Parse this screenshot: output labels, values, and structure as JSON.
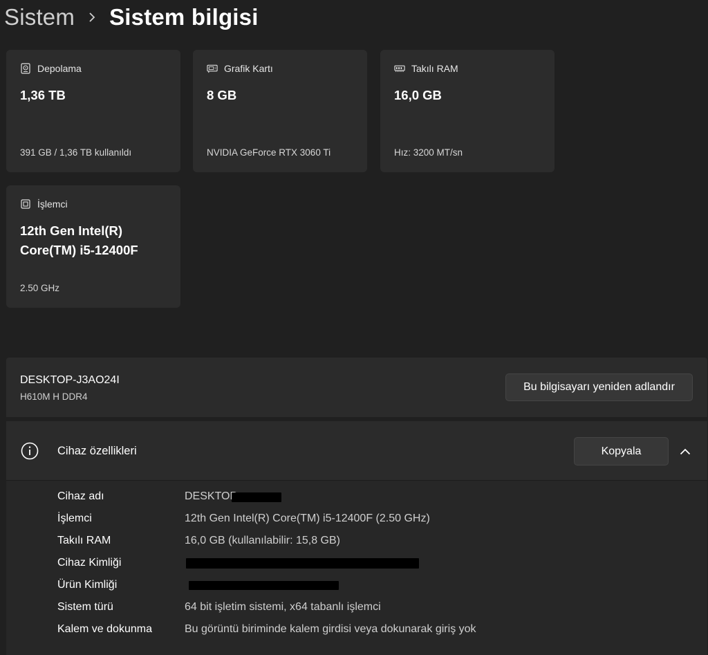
{
  "breadcrumb": {
    "parent": "Sistem",
    "separator_icon": "chevron-right-icon",
    "current": "Sistem bilgisi"
  },
  "cards": {
    "storage": {
      "icon": "hard-drive-icon",
      "title": "Depolama",
      "value": "1,36 TB",
      "detail": "391 GB / 1,36 TB kullanıldı"
    },
    "gpu": {
      "icon": "graphics-card-icon",
      "title": "Grafik Kartı",
      "value": "8 GB",
      "detail": "NVIDIA GeForce RTX 3060 Ti"
    },
    "ram": {
      "icon": "memory-icon",
      "title": "Takılı RAM",
      "value": "16,0 GB",
      "detail": "Hız: 3200 MT/sn"
    },
    "cpu": {
      "icon": "processor-icon",
      "title": "İşlemci",
      "value": "12th Gen Intel(R) Core(TM) i5-12400F",
      "detail": "2.50 GHz"
    }
  },
  "device": {
    "name": "DESKTOP-J3AO24I",
    "model": "H610M H DDR4",
    "rename_label": "Bu bilgisayarı yeniden adlandır"
  },
  "specs": {
    "icon": "info-icon",
    "title": "Cihaz özellikleri",
    "copy_label": "Kopyala",
    "collapse_icon": "chevron-up-icon",
    "rows": [
      {
        "label": "Cihaz adı",
        "value": "DESKTOP-"
      },
      {
        "label": "İşlemci",
        "value": "12th Gen Intel(R) Core(TM) i5-12400F (2.50 GHz)"
      },
      {
        "label": "Takılı RAM",
        "value": "16,0 GB (kullanılabilir: 15,8 GB)"
      },
      {
        "label": "Cihaz Kimliği",
        "value": ""
      },
      {
        "label": "Ürün Kimliği",
        "value": ""
      },
      {
        "label": "Sistem türü",
        "value": "64 bit işletim sistemi, x64 tabanlı işlemci"
      },
      {
        "label": "Kalem ve dokunma",
        "value": "Bu görüntü biriminde kalem girdisi veya dokunarak giriş yok"
      }
    ]
  },
  "colors": {
    "background": "#202020",
    "card": "#2c2c2c",
    "panel": "#2b2b2b",
    "button": "#373737"
  }
}
